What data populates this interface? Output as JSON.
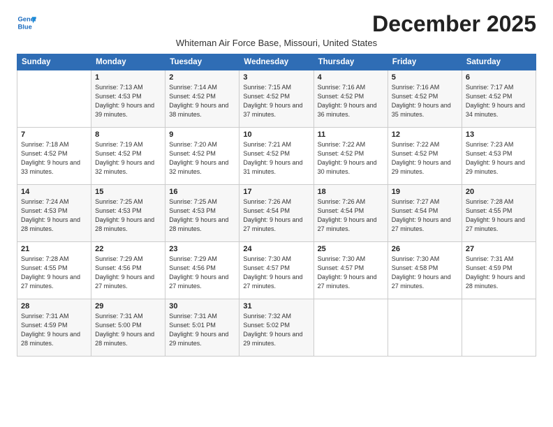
{
  "logo": {
    "line1": "General",
    "line2": "Blue"
  },
  "title": "December 2025",
  "subtitle": "Whiteman Air Force Base, Missouri, United States",
  "header": {
    "days": [
      "Sunday",
      "Monday",
      "Tuesday",
      "Wednesday",
      "Thursday",
      "Friday",
      "Saturday"
    ]
  },
  "weeks": [
    [
      {
        "day": "",
        "info": ""
      },
      {
        "day": "1",
        "info": "Sunrise: 7:13 AM\nSunset: 4:53 PM\nDaylight: 9 hours\nand 39 minutes."
      },
      {
        "day": "2",
        "info": "Sunrise: 7:14 AM\nSunset: 4:52 PM\nDaylight: 9 hours\nand 38 minutes."
      },
      {
        "day": "3",
        "info": "Sunrise: 7:15 AM\nSunset: 4:52 PM\nDaylight: 9 hours\nand 37 minutes."
      },
      {
        "day": "4",
        "info": "Sunrise: 7:16 AM\nSunset: 4:52 PM\nDaylight: 9 hours\nand 36 minutes."
      },
      {
        "day": "5",
        "info": "Sunrise: 7:16 AM\nSunset: 4:52 PM\nDaylight: 9 hours\nand 35 minutes."
      },
      {
        "day": "6",
        "info": "Sunrise: 7:17 AM\nSunset: 4:52 PM\nDaylight: 9 hours\nand 34 minutes."
      }
    ],
    [
      {
        "day": "7",
        "info": "Sunrise: 7:18 AM\nSunset: 4:52 PM\nDaylight: 9 hours\nand 33 minutes."
      },
      {
        "day": "8",
        "info": "Sunrise: 7:19 AM\nSunset: 4:52 PM\nDaylight: 9 hours\nand 32 minutes."
      },
      {
        "day": "9",
        "info": "Sunrise: 7:20 AM\nSunset: 4:52 PM\nDaylight: 9 hours\nand 32 minutes."
      },
      {
        "day": "10",
        "info": "Sunrise: 7:21 AM\nSunset: 4:52 PM\nDaylight: 9 hours\nand 31 minutes."
      },
      {
        "day": "11",
        "info": "Sunrise: 7:22 AM\nSunset: 4:52 PM\nDaylight: 9 hours\nand 30 minutes."
      },
      {
        "day": "12",
        "info": "Sunrise: 7:22 AM\nSunset: 4:52 PM\nDaylight: 9 hours\nand 29 minutes."
      },
      {
        "day": "13",
        "info": "Sunrise: 7:23 AM\nSunset: 4:53 PM\nDaylight: 9 hours\nand 29 minutes."
      }
    ],
    [
      {
        "day": "14",
        "info": "Sunrise: 7:24 AM\nSunset: 4:53 PM\nDaylight: 9 hours\nand 28 minutes."
      },
      {
        "day": "15",
        "info": "Sunrise: 7:25 AM\nSunset: 4:53 PM\nDaylight: 9 hours\nand 28 minutes."
      },
      {
        "day": "16",
        "info": "Sunrise: 7:25 AM\nSunset: 4:53 PM\nDaylight: 9 hours\nand 28 minutes."
      },
      {
        "day": "17",
        "info": "Sunrise: 7:26 AM\nSunset: 4:54 PM\nDaylight: 9 hours\nand 27 minutes."
      },
      {
        "day": "18",
        "info": "Sunrise: 7:26 AM\nSunset: 4:54 PM\nDaylight: 9 hours\nand 27 minutes."
      },
      {
        "day": "19",
        "info": "Sunrise: 7:27 AM\nSunset: 4:54 PM\nDaylight: 9 hours\nand 27 minutes."
      },
      {
        "day": "20",
        "info": "Sunrise: 7:28 AM\nSunset: 4:55 PM\nDaylight: 9 hours\nand 27 minutes."
      }
    ],
    [
      {
        "day": "21",
        "info": "Sunrise: 7:28 AM\nSunset: 4:55 PM\nDaylight: 9 hours\nand 27 minutes."
      },
      {
        "day": "22",
        "info": "Sunrise: 7:29 AM\nSunset: 4:56 PM\nDaylight: 9 hours\nand 27 minutes."
      },
      {
        "day": "23",
        "info": "Sunrise: 7:29 AM\nSunset: 4:56 PM\nDaylight: 9 hours\nand 27 minutes."
      },
      {
        "day": "24",
        "info": "Sunrise: 7:30 AM\nSunset: 4:57 PM\nDaylight: 9 hours\nand 27 minutes."
      },
      {
        "day": "25",
        "info": "Sunrise: 7:30 AM\nSunset: 4:57 PM\nDaylight: 9 hours\nand 27 minutes."
      },
      {
        "day": "26",
        "info": "Sunrise: 7:30 AM\nSunset: 4:58 PM\nDaylight: 9 hours\nand 27 minutes."
      },
      {
        "day": "27",
        "info": "Sunrise: 7:31 AM\nSunset: 4:59 PM\nDaylight: 9 hours\nand 28 minutes."
      }
    ],
    [
      {
        "day": "28",
        "info": "Sunrise: 7:31 AM\nSunset: 4:59 PM\nDaylight: 9 hours\nand 28 minutes."
      },
      {
        "day": "29",
        "info": "Sunrise: 7:31 AM\nSunset: 5:00 PM\nDaylight: 9 hours\nand 28 minutes."
      },
      {
        "day": "30",
        "info": "Sunrise: 7:31 AM\nSunset: 5:01 PM\nDaylight: 9 hours\nand 29 minutes."
      },
      {
        "day": "31",
        "info": "Sunrise: 7:32 AM\nSunset: 5:02 PM\nDaylight: 9 hours\nand 29 minutes."
      },
      {
        "day": "",
        "info": ""
      },
      {
        "day": "",
        "info": ""
      },
      {
        "day": "",
        "info": ""
      }
    ]
  ]
}
